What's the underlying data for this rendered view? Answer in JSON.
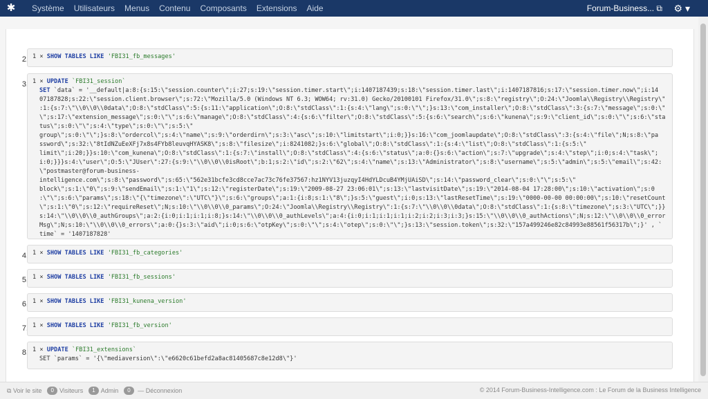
{
  "topbar": {
    "menu": [
      "Système",
      "Utilisateurs",
      "Menus",
      "Contenu",
      "Composants",
      "Extensions",
      "Aide"
    ],
    "site_name": "Forum-Business..."
  },
  "queries": [
    {
      "num": "2.",
      "prefix": "1 × ",
      "kw": "SHOW TABLES LIKE",
      "arg": "'FBI31_fb_messages'"
    },
    {
      "num": "3.",
      "prefix": "1 × ",
      "kw": "UPDATE",
      "arg": "`FBI31_session`"
    },
    {
      "num": "4.",
      "prefix": "1 × ",
      "kw": "SHOW TABLES LIKE",
      "arg": "'FBI31_fb_categories'"
    },
    {
      "num": "5.",
      "prefix": "1 × ",
      "kw": "SHOW TABLES LIKE",
      "arg": "'FBI31_fb_sessions'"
    },
    {
      "num": "6.",
      "prefix": "1 × ",
      "kw": "SHOW TABLES LIKE",
      "arg": "'FBI31_kunena_version'"
    },
    {
      "num": "7.",
      "prefix": "1 × ",
      "kw": "SHOW TABLES LIKE",
      "arg": "'FBI31_fb_version'"
    },
    {
      "num": "8.",
      "prefix": "1 × ",
      "kw": "UPDATE",
      "arg": "`FBI31_extensions`"
    }
  ],
  "q3_set": "SET",
  "q3_lines": [
    "`data` = '__default|a:8:{s:15:\\\"session.counter\\\";i:27;s:19:\\\"session.timer.start\\\";i:1407187439;s:18:\\\"session.timer.last\\\";i:1407187816;s:17:\\\"session.timer.now\\\";i:14",
    "07187828;s:22:\\\"session.client.browser\\\";s:72:\\\"Mozilla/5.0 (Windows NT 6.3; WOW64; rv:31.0) Gecko/20100101 Firefox/31.0\\\";s:8:\\\"registry\\\";O:24:\\\"Joomla\\\\Registry\\\\Registry\\\"",
    ":1:{s:7:\\\"\\\\0\\\\0\\\\0data\\\";O:8:\\\"stdClass\\\":5:{s:11:\\\"application\\\";O:8:\\\"stdClass\\\":1:{s:4:\\\"lang\\\";s:0:\\\"\\\";}s:13:\\\"com_installer\\\";O:8:\\\"stdClass\\\":3:{s:7:\\\"message\\\";s:0:\\\"",
    "\\\";s:17:\\\"extension_message\\\";s:0:\\\"\\\";s:6:\\\"manage\\\";O:8:\\\"stdClass\\\":4:{s:6:\\\"filter\\\";O:8:\\\"stdClass\\\":5:{s:6:\\\"search\\\";s:6:\\\"kunena\\\";s:9:\\\"client_id\\\";s:0:\\\"\\\";s:6:\\\"sta",
    "tus\\\";s:0:\\\"\\\";s:4:\\\"type\\\";s:0:\\\"\\\";s:5:\\\"",
    "  group\\\";s:0:\\\"\\\";}s:8:\\\"ordercol\\\";s:4:\\\"name\\\";s:9:\\\"orderdirn\\\";s:3:\\\"asc\\\";s:10:\\\"limitstart\\\";i:0;}}s:16:\\\"com_joomlaupdate\\\";O:8:\\\"stdClass\\\":3:{s:4:\\\"file\\\";N;s:8:\\\"pa",
    "ssword\\\";s:32:\\\"8tIdNZuEeXFj7x8s4FYb8leuvqHYASK8\\\";s:8:\\\"filesize\\\";i:8241082;}s:6:\\\"global\\\";O:8:\\\"stdClass\\\":1:{s:4:\\\"list\\\";O:8:\\\"stdClass\\\":1:{s:5:\\\"",
    "  limit\\\";i:20;}}s:10:\\\"com_kunena\\\";O:8:\\\"stdClass\\\":1:{s:7:\\\"install\\\";O:8:\\\"stdClass\\\":4:{s:6:\\\"status\\\";a:0:{}s:6:\\\"action\\\";s:7:\\\"upgrade\\\";s:4:\\\"step\\\";i:0;s:4:\\\"task\\\";",
    "i:0;}}}s:4:\\\"user\\\";O:5:\\\"JUser\\\":27:{s:9:\\\"\\\\0\\\\0\\\\0isRoot\\\";b:1;s:2:\\\"id\\\";s:2:\\\"62\\\";s:4:\\\"name\\\";s:13:\\\"Administrator\\\";s:8:\\\"username\\\";s:5:\\\"admin\\\";s:5:\\\"email\\\";s:42:",
    "\\\"postmaster@forum-business-intelligence.com\\\";s:8:\\\"password\\\";s:65:\\\"562e31bcfe3cd8cce7ac73c76fe37567:hz1NYV13juzqyI4HdYLDcuB4YMjUAiSD\\\";s:14:\\\"password_clear\\\";s:0:\\\"\\\";s:5:\\\"",
    "block\\\";s:1:\\\"0\\\";s:9:\\\"sendEmail\\\";s:1:\\\"1\\\";s:12:\\\"registerDate\\\";s:19:\\\"2009-08-27 23:06:01\\\";s:13:\\\"lastvisitDate\\\";s:19:\\\"2014-08-04 17:28:00\\\";s:10:\\\"activation\\\";s:0",
    ":\\\"\\\";s:6:\\\"params\\\";s:18:\\\"{\\\"timezone\\\":\\\"UTC\\\"}\\\";s:6:\\\"groups\\\";a:1:{i:8;s:1:\\\"8\\\";}s:5:\\\"guest\\\";i:0;s:13:\\\"lastResetTime\\\";s:19:\\\"0000-00-00 00:00:00\\\";s:10:\\\"resetCount",
    "\\\";s:1:\\\"0\\\";s:12:\\\"requireReset\\\";N;s:10:\\\"\\\\0\\\\0\\\\0_params\\\";O:24:\\\"Joomla\\\\Registry\\\\Registry\\\":1:{s:7:\\\"\\\\0\\\\0\\\\0data\\\";O:8:\\\"stdClass\\\":1:{s:8:\\\"timezone\\\";s:3:\\\"UTC\\\";}}",
    "s:14:\\\"\\\\0\\\\0\\\\0_authGroups\\\";a:2:{i:0;i:1;i:1;i:8;}s:14:\\\"\\\\0\\\\0\\\\0_authLevels\\\";a:4:{i:0;i:1;i:1;i:1;i:2;i:2;i:3;i:3;}s:15:\\\"\\\\0\\\\0\\\\0_authActions\\\";N;s:12:\\\"\\\\0\\\\0\\\\0_error",
    "Msg\\\";N;s:10:\\\"\\\\0\\\\0\\\\0_errors\\\";a:0:{}s:3:\\\"aid\\\";i:0;s:6:\\\"otpKey\\\";s:0:\\\"\\\";s:4:\\\"otep\\\";s:0:\\\"\\\";}s:13:\\\"session.token\\\";s:32:\\\"157a499246e82c84993e88561f56317b\\\";}'  , `",
    "time` = '1407187828'"
  ],
  "q8_line": "SET `params` = '{\\\"mediaversion\\\":\\\"e6620c61befd2a8ac81405687c8e12d8\\\"}'",
  "footer": {
    "voir": "Voir le site",
    "visiteurs_count": "0",
    "visiteurs": "Visiteurs",
    "admin_count": "1",
    "admin": "Admin",
    "deco_count": "0",
    "deco": "Déconnexion",
    "copyright": "© 2014 Forum-Business-Intelligence.com : Le Forum de la Business Intelligence"
  }
}
